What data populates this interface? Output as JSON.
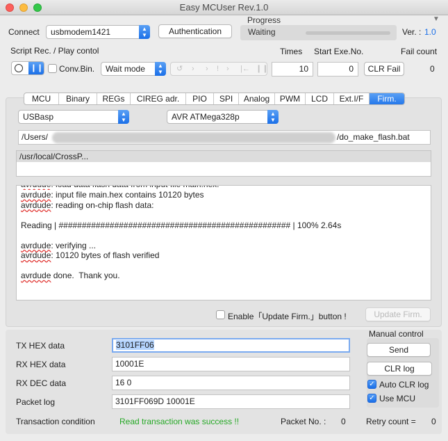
{
  "window": {
    "title": "Easy MCUser Rev.1.0"
  },
  "connect": {
    "label": "Connect",
    "port": "usbmodem1421",
    "auth_button": "Authentication"
  },
  "progress": {
    "label": "Progress",
    "status": "Waiting",
    "ver_label": "Ver. :",
    "ver_value": "1.0"
  },
  "script": {
    "label": "Script Rec. / Play contol",
    "conv_bin": "Conv.Bin.",
    "mode": "Wait mode",
    "times_label": "Times",
    "times_value": "10",
    "start_label": "Start Exe.No.",
    "start_value": "0",
    "fail_label": "Fail count",
    "fail_value": "0",
    "clr_fail": "CLR Fail"
  },
  "tabs": [
    {
      "label": "MCU",
      "active": false
    },
    {
      "label": "Binary",
      "active": false
    },
    {
      "label": "REGs",
      "active": false
    },
    {
      "label": "CIREG adr.",
      "active": false
    },
    {
      "label": "PIO",
      "active": false
    },
    {
      "label": "SPI",
      "active": false
    },
    {
      "label": "Analog",
      "active": false
    },
    {
      "label": "PWM",
      "active": false
    },
    {
      "label": "LCD",
      "active": false
    },
    {
      "label": "Ext.I/F",
      "active": false
    },
    {
      "label": "Firm.",
      "active": true
    }
  ],
  "firm": {
    "programmer": "USBasp",
    "device": "AVR ATMega328p",
    "path_start": "/Users/",
    "path_end": "/do_make_flash.bat",
    "tool_path": "/usr/local/CrossP...",
    "log_lines": [
      "avrdude: input file main.hex contains 10120 bytes",
      "avrdude: reading on-chip flash data:",
      "",
      "Reading | ################################################## | 100% 2.64s",
      "",
      "avrdude: verifying ...",
      "avrdude: 10120 bytes of flash verified",
      "",
      "avrdude done.  Thank you."
    ],
    "enable_label": "Enable「Update Firm.」button !",
    "update_button": "Update Firm."
  },
  "comm": {
    "tx_label": "TX HEX data",
    "tx_value": "3101FF06",
    "rx_label": "RX HEX data",
    "rx_value": "10001E",
    "rxdec_label": "RX DEC data",
    "rxdec_value": "16 0",
    "packet_label": "Packet log",
    "packet_value": "3101FF069D 10001E"
  },
  "manual": {
    "label": "Manual control",
    "send": "Send",
    "clr_log": "CLR log",
    "auto_clr": "Auto CLR log",
    "use_mcu": "Use MCU"
  },
  "status": {
    "transaction_label": "Transaction condition",
    "transaction_value": "Read transaction was success !!",
    "packet_no_label": "Packet No. :",
    "packet_no_value": "0",
    "retry_label": "Retry count  =",
    "retry_value": "0"
  },
  "colors": {
    "accent": "#1a6fe8",
    "success": "#24a824"
  }
}
